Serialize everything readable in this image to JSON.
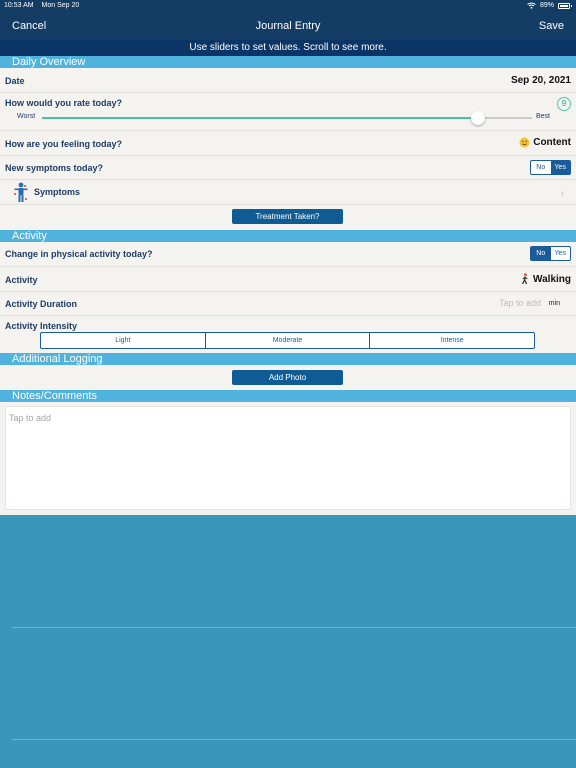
{
  "status": {
    "time": "10:53 AM",
    "date": "Mon Sep 20",
    "battery": "89%"
  },
  "nav": {
    "cancel": "Cancel",
    "title": "Journal Entry",
    "save": "Save"
  },
  "hint": "Use sliders to set values. Scroll to see more.",
  "daily": {
    "header": "Daily Overview",
    "date_label": "Date",
    "date_value": "Sep 20, 2021",
    "rate_label": "How would you rate today?",
    "rating": 9,
    "rating_fraction": 0.89,
    "worst": "Worst",
    "best": "Best",
    "feeling_label": "How are you feeling today?",
    "feeling_value": "Content",
    "feeling_icon": "slightly-smiling-face-icon",
    "new_symptoms_label": "New symptoms today?",
    "no": "No",
    "yes": "Yes",
    "new_symptoms_selected": "Yes",
    "symptoms_label": "Symptoms",
    "treatment_button": "Treatment Taken?"
  },
  "activity": {
    "header": "Activity",
    "change_label": "Change in physical activity today?",
    "no": "No",
    "yes": "Yes",
    "change_selected": "No",
    "activity_label": "Activity",
    "activity_value": "Walking",
    "activity_icon": "walking-person-icon",
    "duration_label": "Activity Duration",
    "duration_placeholder": "Tap to add",
    "duration_unit": "min",
    "intensity_label": "Activity Intensity",
    "intensity_options": [
      "Light",
      "Moderate",
      "Intense"
    ]
  },
  "additional": {
    "header": "Additional Logging",
    "add_photo": "Add Photo"
  },
  "notes": {
    "header": "Notes/Comments",
    "placeholder": "Tap to add"
  },
  "colors": {
    "nav": "#143d66",
    "section": "#4fb3de",
    "accent": "#0f5c94",
    "slider": "#4cc0a0",
    "background": "#3a97b9"
  }
}
